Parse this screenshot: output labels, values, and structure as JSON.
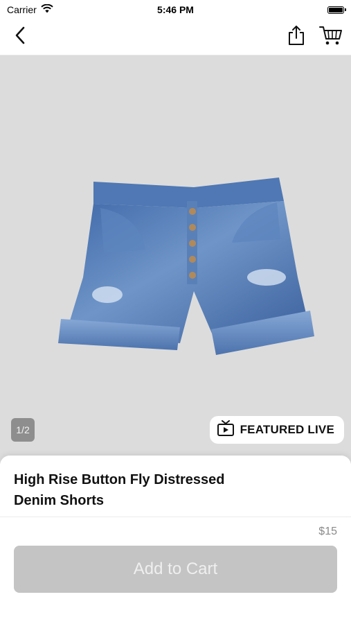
{
  "status_bar": {
    "carrier": "Carrier",
    "time": "5:46 PM"
  },
  "nav": {
    "back_icon": "chevron-left-icon",
    "share_icon": "share-icon",
    "cart_icon": "cart-icon"
  },
  "hero": {
    "page_indicator": "1/2",
    "featured_live_label": "FEATURED LIVE",
    "background_color": "#dcdcdc"
  },
  "product": {
    "title": "High Rise Button Fly Distressed Denim Shorts",
    "price": "$15",
    "add_to_cart_label": "Add to Cart"
  }
}
